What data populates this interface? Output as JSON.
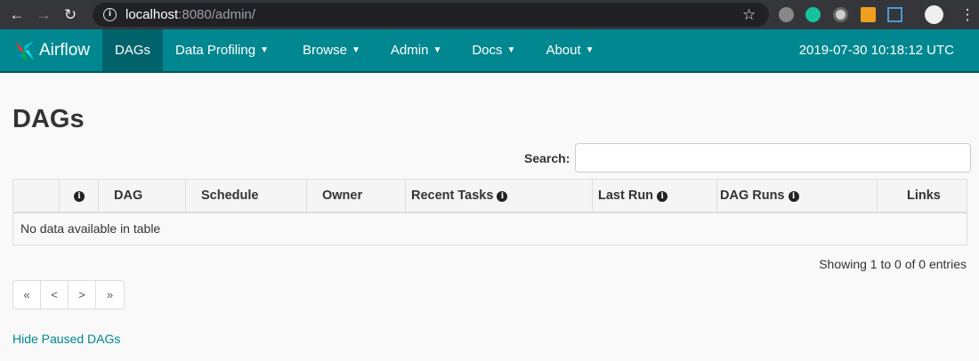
{
  "browser": {
    "url_host": "localhost",
    "url_path": ":8080/admin/"
  },
  "nav": {
    "brand": "Airflow",
    "items": [
      {
        "label": "DAGs"
      },
      {
        "label": "Data Profiling"
      },
      {
        "label": "Browse"
      },
      {
        "label": "Admin"
      },
      {
        "label": "Docs"
      },
      {
        "label": "About"
      }
    ],
    "time": "2019-07-30 10:18:12 UTC"
  },
  "page": {
    "title": "DAGs",
    "search_label": "Search:",
    "search_value": ""
  },
  "table": {
    "headers": [
      "",
      "",
      "DAG",
      "Schedule",
      "Owner",
      "Recent Tasks",
      "Last Run",
      "DAG Runs",
      "Links"
    ],
    "empty": "No data available in table"
  },
  "info": "Showing 1 to 0 of 0 entries",
  "pager": [
    "«",
    "<",
    ">",
    "»"
  ],
  "hide_paused": "Hide Paused DAGs",
  "colors": {
    "nav": "#00878f",
    "active": "#00626a"
  }
}
